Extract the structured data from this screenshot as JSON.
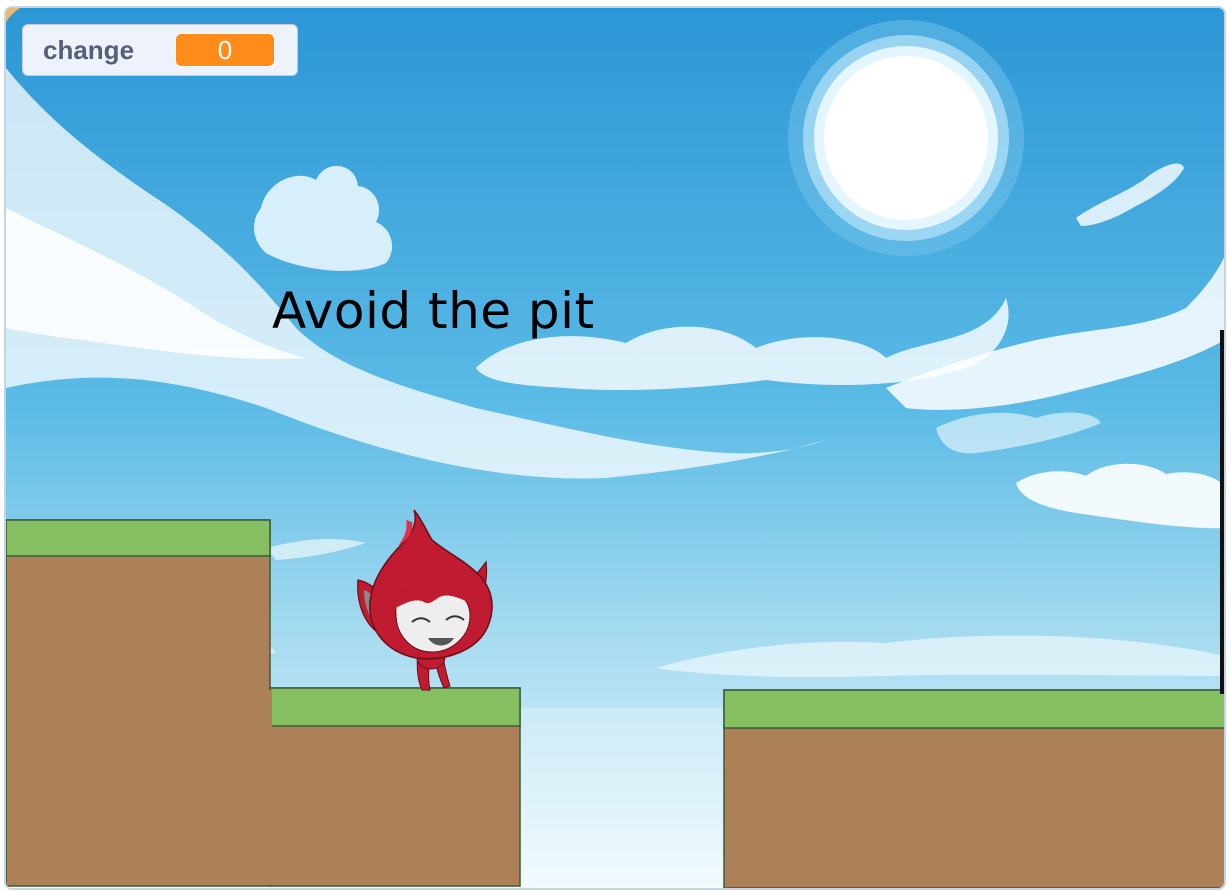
{
  "variable_monitor": {
    "label": "change",
    "value": "0"
  },
  "speech": {
    "text": "Avoid the pit"
  },
  "colors": {
    "grass": "#86bf62",
    "dirt": "#ad8158",
    "monitor_value": "#ff8c1a",
    "sky_top": "#2e9ad8",
    "sky_bottom": "#e8f8fc"
  },
  "sprites": {
    "player": "red-fox-character"
  }
}
